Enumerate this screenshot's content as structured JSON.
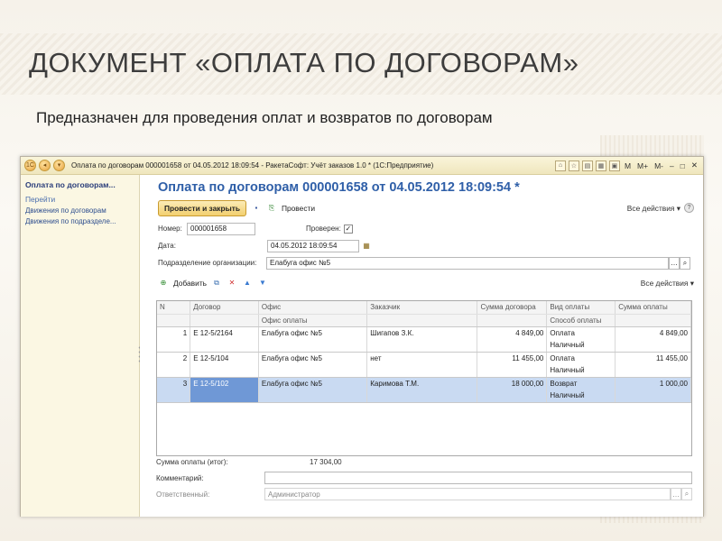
{
  "slide": {
    "title": "Документ «Оплата по договорам»",
    "subtitle": "Предназначен для проведения оплат и возвратов по договорам"
  },
  "window": {
    "title": "Оплата по договорам 000001658 от 04.05.2012 18:09:54 - РакетаСофт: Учёт заказов 1.0 * (1С:Предприятие)",
    "tb_m": "M",
    "tb_mplus": "M+",
    "tb_mminus": "M-",
    "tb_min": "–",
    "tb_max": "□",
    "tb_close": "✕"
  },
  "left_panel": {
    "title": "Оплата по договорам...",
    "section": "Перейти",
    "links": [
      "Движения по договорам",
      "Движения по подразделе..."
    ]
  },
  "form": {
    "title": "Оплата по договорам 000001658 от 04.05.2012 18:09:54 *",
    "post_close": "Провести и закрыть",
    "post": "Провести",
    "all_actions": "Все действия ▾",
    "number_label": "Номер:",
    "number_value": "000001658",
    "checked_label": "Проверен:",
    "date_label": "Дата:",
    "date_value": "04.05.2012 18:09:54",
    "dept_label": "Подразделение организации:",
    "dept_value": "Елабуга офис №5",
    "add": "Добавить",
    "table_all_actions": "Все действия ▾"
  },
  "table": {
    "headers": {
      "n": "N",
      "contract": "Договор",
      "office": "Офис",
      "office2": "Офис оплаты",
      "customer": "Заказчик",
      "sum_contract": "Сумма договора",
      "pay_type": "Вид оплаты",
      "pay_method": "Способ оплаты",
      "sum_pay": "Сумма оплаты"
    },
    "rows": [
      {
        "n": "1",
        "contract": "Е 12-5/2164",
        "office": "Елабуга офис №5",
        "customer": "Шигапов З.К.",
        "sum_contract": "4 849,00",
        "pay_type": "Оплата",
        "pay_method": "Наличный",
        "sum_pay": "4 849,00"
      },
      {
        "n": "2",
        "contract": "Е 12-5/104",
        "office": "Елабуга офис №5",
        "customer": "нет",
        "sum_contract": "11 455,00",
        "pay_type": "Оплата",
        "pay_method": "Наличный",
        "sum_pay": "11 455,00"
      },
      {
        "n": "3",
        "contract": "Е 12-5/102",
        "office": "Елабуга офис №5",
        "customer": "Каримова Т.М.",
        "sum_contract": "18 000,00",
        "pay_type": "Возврат",
        "pay_method": "Наличный",
        "sum_pay": "1 000,00"
      }
    ]
  },
  "footer": {
    "total_label": "Сумма оплаты (итог):",
    "total_value": "17 304,00",
    "comment_label": "Комментарий:",
    "responsible_label": "Ответственный:",
    "responsible_value": "Администратор"
  }
}
